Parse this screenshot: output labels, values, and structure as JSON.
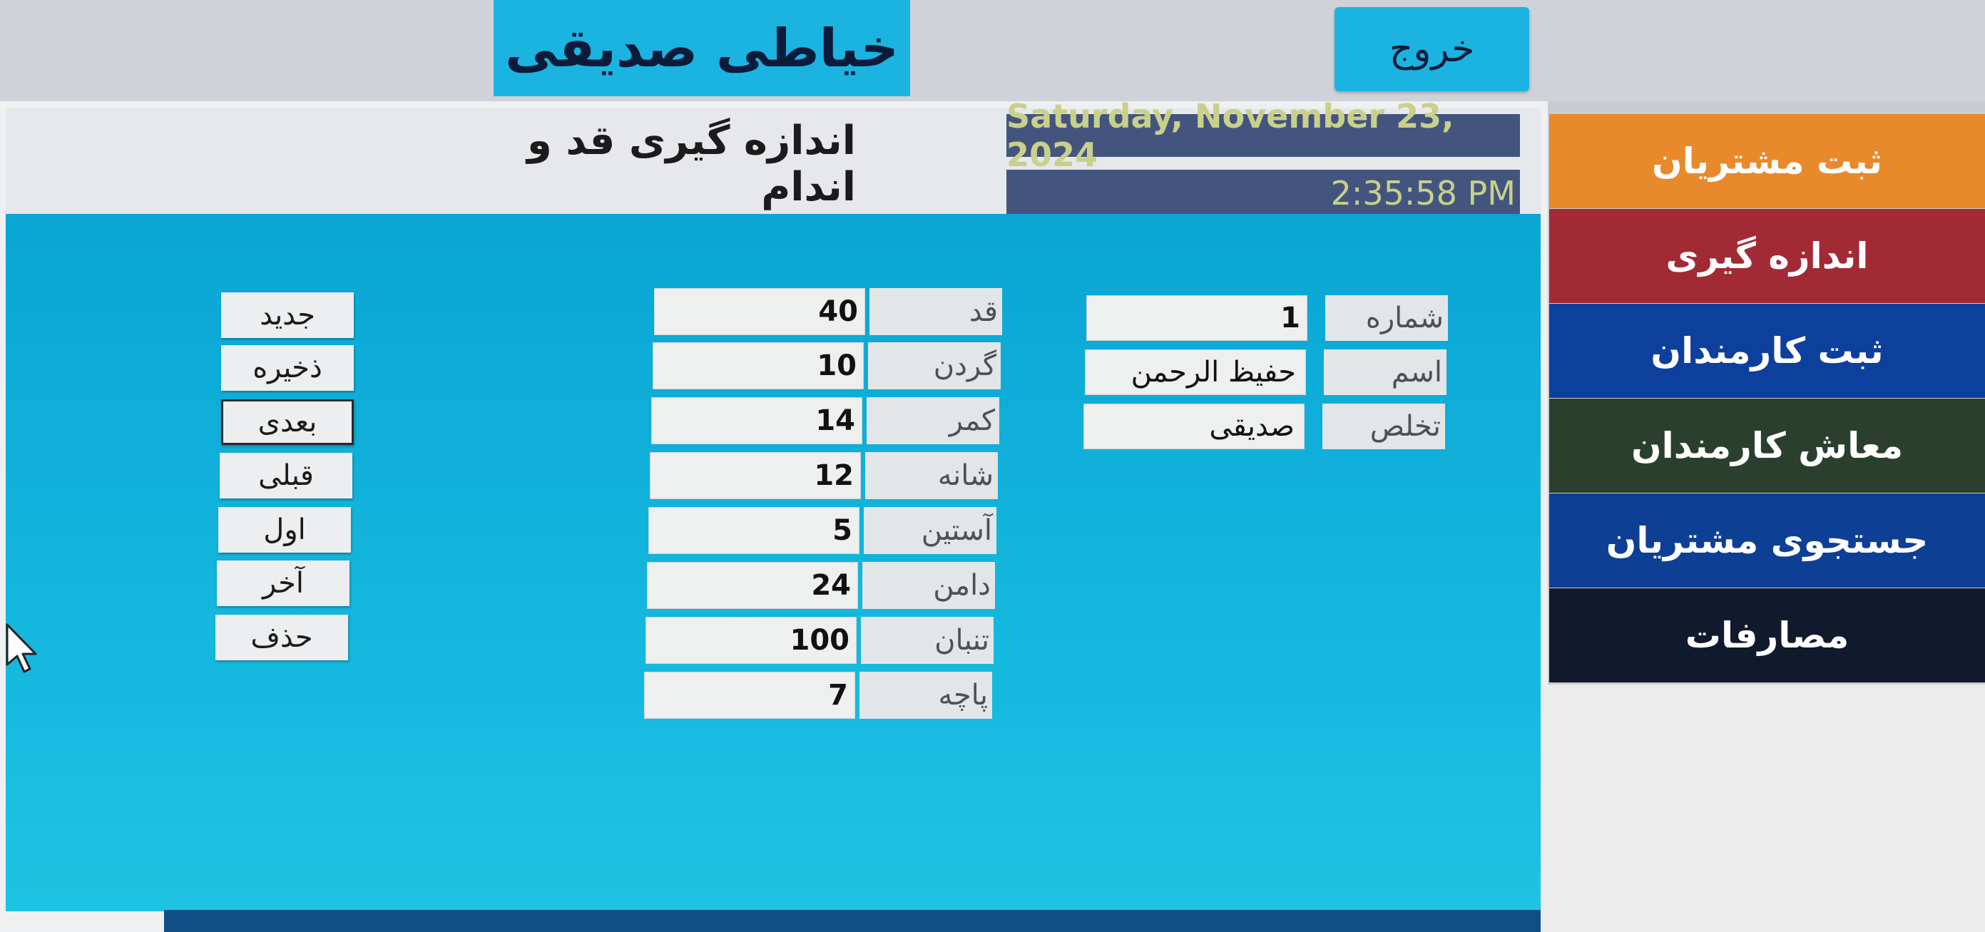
{
  "header": {
    "app_title": "خیاطی صدیقی",
    "exit_label": "خروج"
  },
  "page": {
    "heading": "اندازه گیری قد و اندام",
    "date": "Saturday, November 23, 2024",
    "time": "2:35:58 PM"
  },
  "customer": {
    "fields": [
      {
        "label": "شماره",
        "value": "1"
      },
      {
        "label": "اسم",
        "value": "حفیظ الرحمن"
      },
      {
        "label": "تخلص",
        "value": "صدیقی"
      }
    ]
  },
  "measurements": {
    "fields": [
      {
        "label": "قد",
        "value": "40"
      },
      {
        "label": "گردن",
        "value": "10"
      },
      {
        "label": "کمر",
        "value": "14"
      },
      {
        "label": "شانه",
        "value": "12"
      },
      {
        "label": "آستین",
        "value": "5"
      },
      {
        "label": "دامن",
        "value": "24"
      },
      {
        "label": "تنبان",
        "value": "100"
      },
      {
        "label": "پاچه",
        "value": "7"
      }
    ]
  },
  "actions": {
    "items": [
      {
        "label": "جدید"
      },
      {
        "label": "ذخیره"
      },
      {
        "label": "بعدی"
      },
      {
        "label": "قبلی"
      },
      {
        "label": "اول"
      },
      {
        "label": "آخر"
      },
      {
        "label": "حذف"
      }
    ]
  },
  "sidebar": {
    "items": [
      {
        "label": "ثبت مشتریان",
        "color": "#e8892b"
      },
      {
        "label": "اندازه گیری",
        "color": "#a12a35"
      },
      {
        "label": "ثبت کارمندان",
        "color": "#0d3f9c"
      },
      {
        "label": "معاش کارمندان",
        "color": "#2b3f2e"
      },
      {
        "label": "جستجوی مشتریان",
        "color": "#0d3f95"
      },
      {
        "label": "مصارفات",
        "color": "#101a2c"
      }
    ]
  },
  "colors": {
    "accent": "#1bb3e0",
    "panel": "#13b6dd",
    "date_bg": "#43557f",
    "date_text": "#c9d08a"
  }
}
